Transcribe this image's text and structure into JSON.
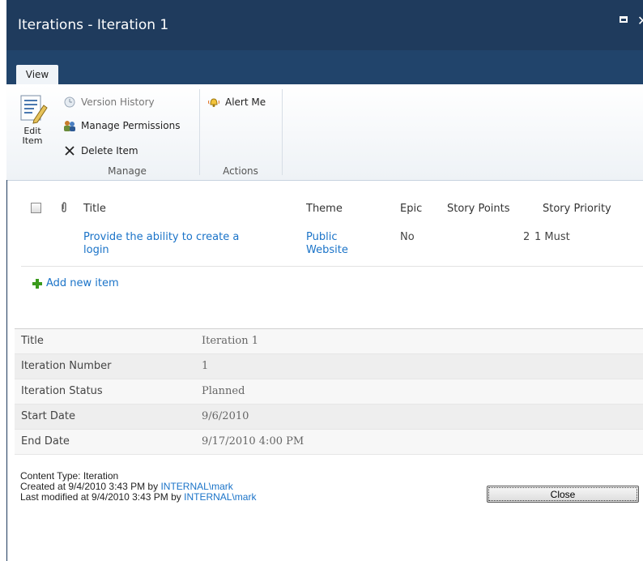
{
  "dialog": {
    "title": "Iterations - Iteration 1"
  },
  "tabs": [
    {
      "label": "View"
    }
  ],
  "ribbon": {
    "edit_item_label_line1": "Edit",
    "edit_item_label_line2": "Item",
    "version_history": "Version History",
    "manage_permissions": "Manage Permissions",
    "delete_item": "Delete Item",
    "alert_me": "Alert Me",
    "group_manage": "Manage",
    "group_actions": "Actions"
  },
  "list": {
    "columns": [
      "Title",
      "Theme",
      "Epic",
      "Story Points",
      "Story Priority"
    ],
    "rows": [
      {
        "title_line1": "Provide the ability to create a",
        "title_line2": "login",
        "theme_line1": "Public",
        "theme_line2": "Website",
        "epic": "No",
        "story_points": "2",
        "story_priority": "1 Must"
      }
    ],
    "add_new_item": "Add new item"
  },
  "properties": [
    {
      "label": "Title",
      "value": "Iteration 1"
    },
    {
      "label": "Iteration Number",
      "value": "1"
    },
    {
      "label": "Iteration Status",
      "value": "Planned"
    },
    {
      "label": "Start Date",
      "value": "9/6/2010"
    },
    {
      "label": "End Date",
      "value": "9/17/2010 4:00 PM"
    }
  ],
  "footer": {
    "content_type": "Content Type: Iteration",
    "created_prefix": "Created at 9/4/2010 3:43 PM by ",
    "created_user": "INTERNAL\\mark",
    "modified_prefix": "Last modified at 9/4/2010 3:43 PM by ",
    "modified_user": "INTERNAL\\mark"
  },
  "buttons": {
    "close": "Close"
  }
}
